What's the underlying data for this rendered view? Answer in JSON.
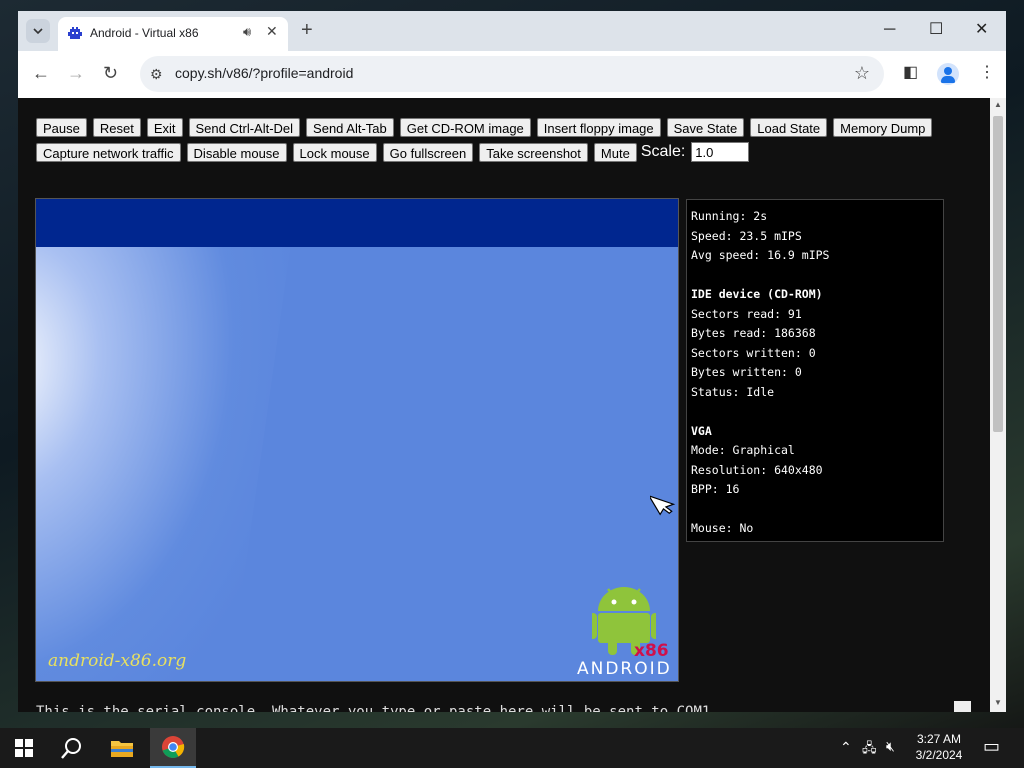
{
  "browser": {
    "tab_title": "Android - Virtual x86",
    "url": "copy.sh/v86/?profile=android",
    "new_tab_symbol": "+",
    "window_controls": {
      "minimize": "─",
      "maximize": "☐",
      "close": "✕"
    }
  },
  "toolbar_buttons_row1": [
    "Pause",
    "Reset",
    "Exit",
    "Send Ctrl-Alt-Del",
    "Send Alt-Tab",
    "Get CD-ROM image",
    "Insert floppy image",
    "Save State",
    "Load State",
    "Memory Dump"
  ],
  "toolbar_buttons_row2": [
    "Capture network traffic",
    "Disable mouse",
    "Lock mouse",
    "Go fullscreen",
    "Take screenshot",
    "Mute"
  ],
  "scale": {
    "label": "Scale:",
    "value": "1.0"
  },
  "emulator": {
    "brand_text": "android-x86.org",
    "logo_x86": "x86",
    "logo_wordmark": "ANDROID",
    "colors": {
      "screen": "#5b86dd",
      "bar": "#00268f",
      "android_green": "#8fc43b"
    }
  },
  "info_panel": {
    "running": "Running: 2s",
    "speed": "Speed: 23.5 mIPS",
    "avg_speed": "Avg speed: 16.9 mIPS",
    "ide_header": "IDE device (CD-ROM)",
    "sectors_read": "Sectors read: 91",
    "bytes_read": "Bytes read: 186368",
    "sectors_written": "Sectors written: 0",
    "bytes_written": "Bytes written: 0",
    "status": "Status: Idle",
    "vga_header": "VGA",
    "mode": "Mode: Graphical",
    "resolution": "Resolution: 640x480",
    "bpp": "BPP: 16",
    "mouse": "Mouse: No"
  },
  "serial_console": "This is the serial console. Whatever you type or paste here will be sent to COM1",
  "taskbar": {
    "time": "3:27 AM",
    "date": "3/2/2024"
  }
}
